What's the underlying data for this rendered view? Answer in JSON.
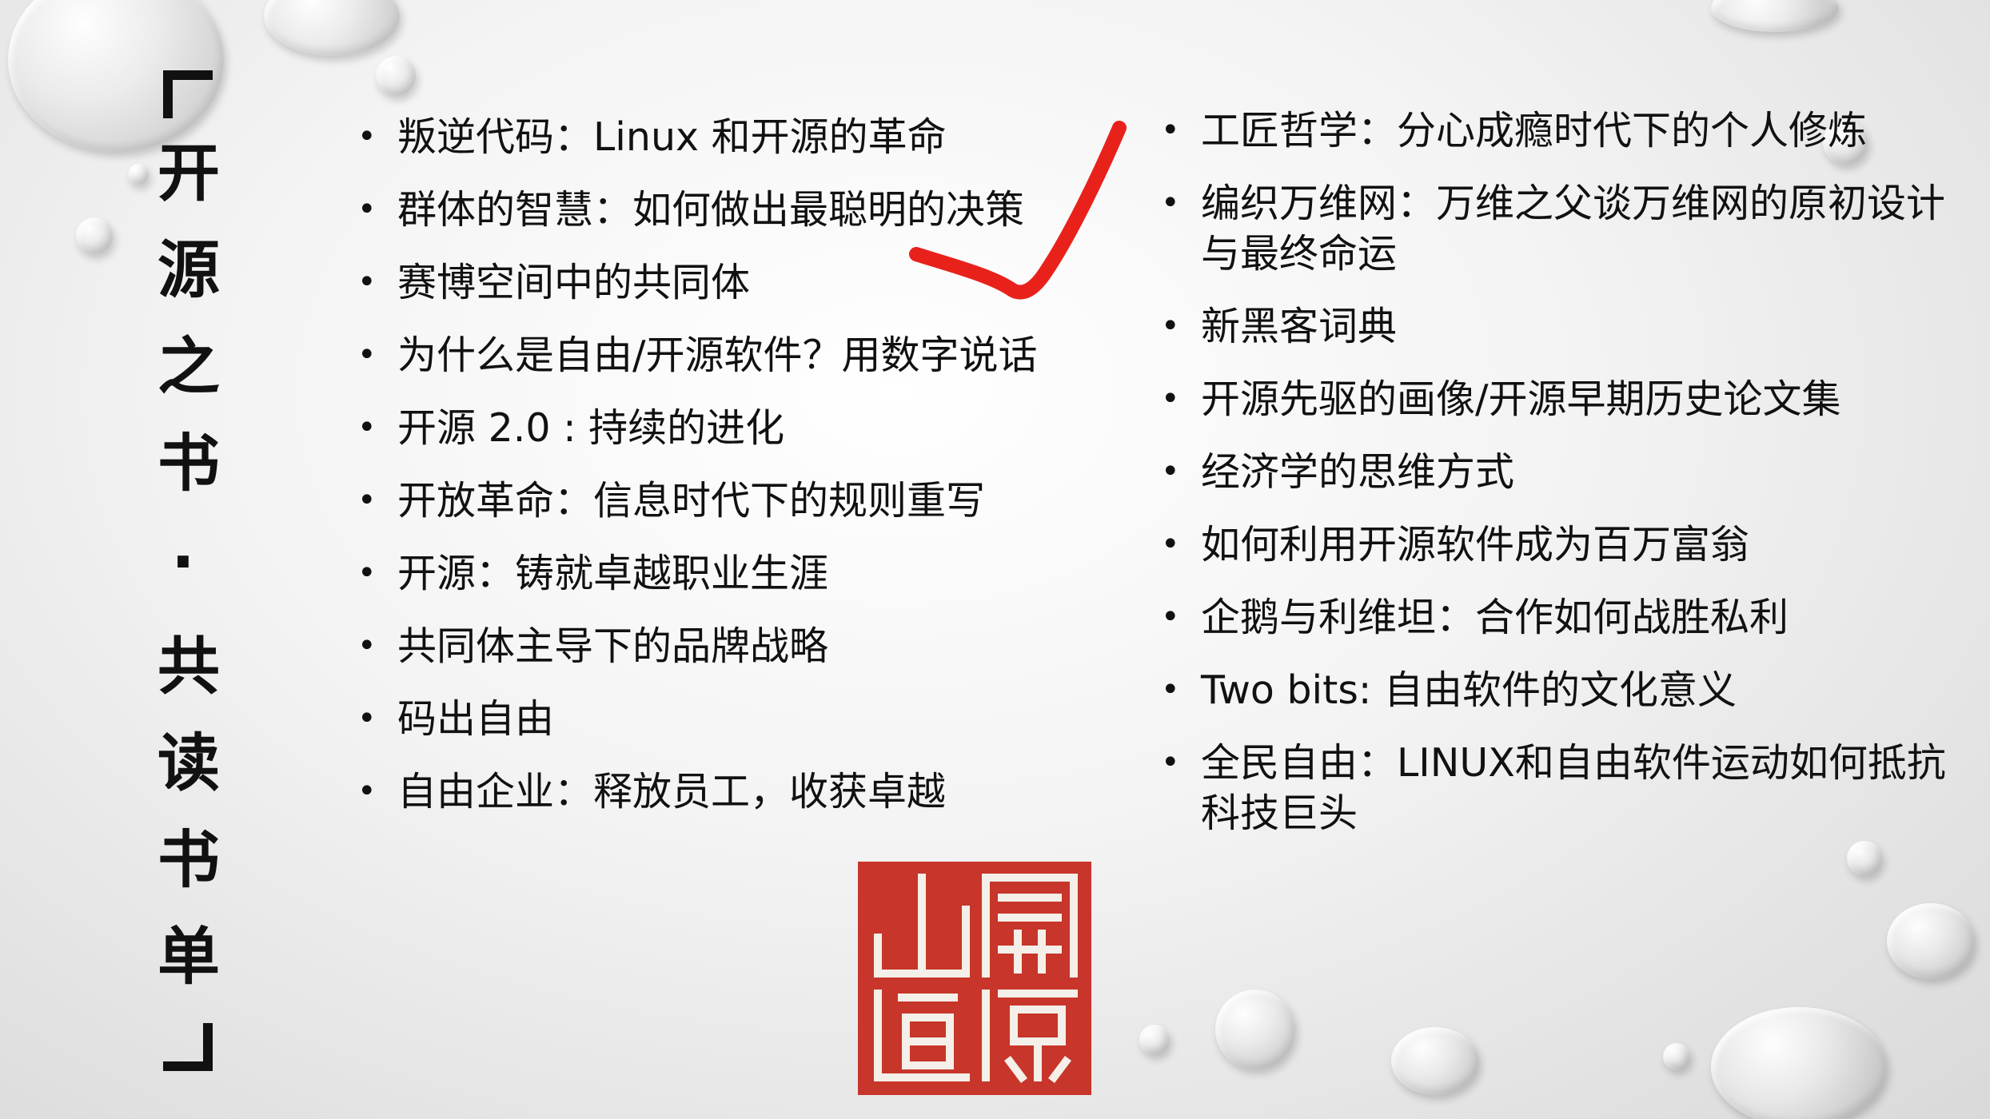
{
  "title": {
    "bracket_open": "「",
    "text": "开源之书·共读书单",
    "bracket_close": "」"
  },
  "left_books": [
    "叛逆代码：Linux 和开源的革命",
    "群体的智慧：如何做出最聪明的决策",
    "赛博空间中的共同体",
    "为什么是自由/开源软件？用数字说话",
    "开源 2.0 : 持续的进化",
    "开放革命：信息时代下的规则重写",
    "开源：铸就卓越职业生涯",
    "共同体主导下的品牌战略",
    "码出自由",
    "自由企业：释放员工，收获卓越"
  ],
  "right_books": [
    "工匠哲学：分心成瘾时代下的个人修炼",
    "编织万维网：万维之父谈万维网的原初设计与最终命运",
    "新黑客词典",
    "开源先驱的画像/开源早期历史论文集",
    "经济学的思维方式",
    "如何利用开源软件成为百万富翁",
    "企鹅与利维坦：合作如何战胜私利",
    "Two bits: 自由软件的文化意义",
    "全民自由：LINUX和自由软件运动如何抵抗科技巨头"
  ],
  "seal_text": "開源之道",
  "colors": {
    "checkmark": "#e8221b",
    "seal": "#c8352a",
    "text": "#111111"
  },
  "icons": {
    "checkmark": "red-checkmark-icon",
    "seal": "seal-stamp-icon"
  }
}
